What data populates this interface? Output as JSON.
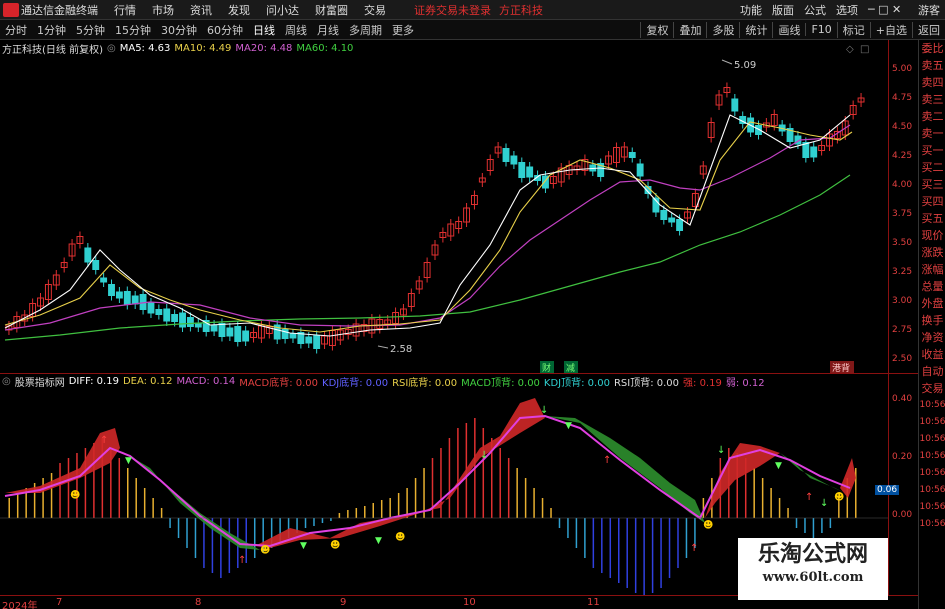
{
  "menubar": {
    "app_name": "通达信金融终端",
    "items": [
      "行情",
      "市场",
      "资讯",
      "发现",
      "问小达",
      "财富圈",
      "交易"
    ],
    "login_text": "证券交易未登录",
    "brand": "方正科技",
    "right_items": [
      "功能",
      "版面",
      "公式",
      "选项"
    ],
    "guest": "游客"
  },
  "toolbar": {
    "periods": [
      "分时",
      "1分钟",
      "5分钟",
      "15分钟",
      "30分钟",
      "60分钟",
      "日线",
      "周线",
      "月线",
      "多周期",
      "更多"
    ],
    "active_period": "日线",
    "buttons": [
      "复权",
      "叠加",
      "多股",
      "统计",
      "画线",
      "F10",
      "标记",
      "+自选",
      "返回"
    ]
  },
  "main": {
    "stock_label": "方正科技(日线 前复权)",
    "ma5": "MA5: 4.63",
    "ma10": "MA10: 4.49",
    "ma20": "MA20: 4.48",
    "ma60": "MA60: 4.10",
    "high_mark": "5.09",
    "low_mark": "2.58",
    "tag_cai": "财",
    "tag_jian": "减",
    "tag_bei": "港背",
    "yaxis": [
      "5.00",
      "4.75",
      "4.50",
      "4.25",
      "4.00",
      "3.75",
      "3.50",
      "3.25",
      "3.00",
      "2.75",
      "2.50"
    ]
  },
  "indicator": {
    "name": "股票指标网",
    "diff": "DIFF: 0.19",
    "dea": "DEA: 0.12",
    "macd": "MACD: 0.14",
    "macd_bottom": "MACD底背: 0.00",
    "kdj_bottom": "KDJ底背: 0.00",
    "rsi_bottom": "RSI底背: 0.00",
    "macd_top": "MACD顶背: 0.00",
    "kdj_top": "KDJ顶背: 0.00",
    "rsi_top": "RSI顶背: 0.00",
    "red_val": "强: 0.19",
    "purple_val": "弱: 0.12",
    "yaxis": [
      "0.40",
      "0.20",
      "0.06",
      "0.00"
    ]
  },
  "right_panel": {
    "items": [
      "委比",
      "卖五",
      "卖四",
      "卖三",
      "卖二",
      "卖一",
      "买一",
      "买二",
      "买三",
      "买四",
      "买五",
      "现价",
      "涨跌",
      "涨幅",
      "总量",
      "外盘",
      "换手",
      "净资",
      "收益",
      "自动",
      "交易",
      "10:56",
      "10:56",
      "10:56",
      "10:56",
      "10:56",
      "10:56",
      "10:56",
      "10:56"
    ]
  },
  "dates": [
    "2024年",
    "7",
    "8",
    "9",
    "10",
    "11"
  ],
  "watermark": {
    "title": "乐淘公式网",
    "url": "www.60lt.com"
  },
  "colors": {
    "up": "#e03030",
    "down": "#30d0d0",
    "ma5": "#ffffff",
    "ma10": "#e8d04a",
    "ma20": "#d060d0",
    "ma60": "#40d040",
    "axis": "#e04040"
  }
}
